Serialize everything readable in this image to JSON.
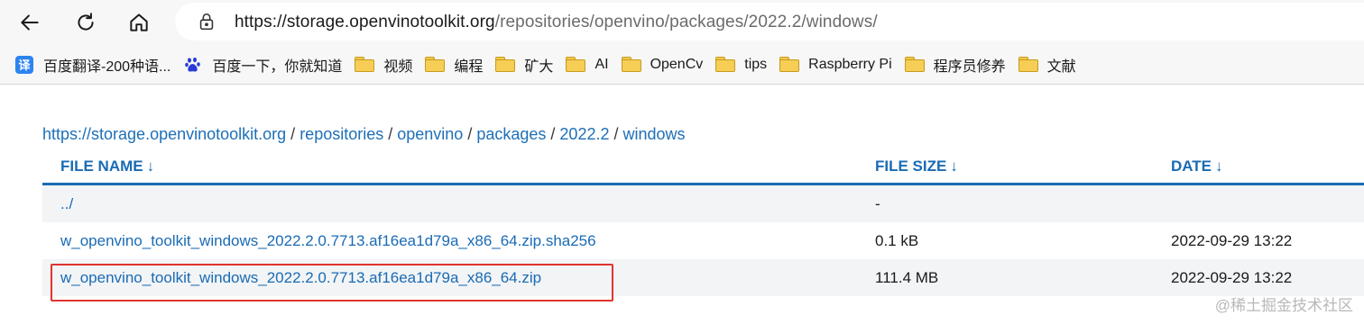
{
  "browser": {
    "url_host": "https://storage.openvinotoolkit.org",
    "url_path": "/repositories/openvino/packages/2022.2/windows/",
    "back_icon": "arrow-left-icon",
    "refresh_icon": "refresh-icon",
    "home_icon": "home-icon",
    "lock_icon": "lock-icon"
  },
  "bookmarks": [
    {
      "label": "百度翻译-200种语...",
      "icon": "translate-icon"
    },
    {
      "label": "百度一下，你就知道",
      "icon": "baidu-paw-icon"
    },
    {
      "label": "视频",
      "icon": "folder-icon"
    },
    {
      "label": "编程",
      "icon": "folder-icon"
    },
    {
      "label": "矿大",
      "icon": "folder-icon"
    },
    {
      "label": "AI",
      "icon": "folder-icon"
    },
    {
      "label": "OpenCv",
      "icon": "folder-icon"
    },
    {
      "label": "tips",
      "icon": "folder-icon"
    },
    {
      "label": "Raspberry Pi",
      "icon": "folder-icon"
    },
    {
      "label": "程序员修养",
      "icon": "folder-icon"
    },
    {
      "label": "文献",
      "icon": "folder-icon"
    }
  ],
  "breadcrumb": {
    "items": [
      "https://storage.openvinotoolkit.org",
      "repositories",
      "openvino",
      "packages",
      "2022.2",
      "windows"
    ],
    "separator": "/"
  },
  "table": {
    "headers": {
      "name": "FILE NAME",
      "size": "FILE SIZE",
      "date": "DATE",
      "sort_arrow": "↓"
    },
    "rows": [
      {
        "name": "../",
        "size": "-",
        "date": ""
      },
      {
        "name": "w_openvino_toolkit_windows_2022.2.0.7713.af16ea1d79a_x86_64.zip.sha256",
        "size": "0.1 kB",
        "date": "2022-09-29 13:22"
      },
      {
        "name": "w_openvino_toolkit_windows_2022.2.0.7713.af16ea1d79a_x86_64.zip",
        "size": "111.4 MB",
        "date": "2022-09-29 13:22"
      }
    ]
  },
  "watermark": "@稀土掘金技术社区",
  "colors": {
    "link": "#1a6bb4",
    "header_rule": "#1a6bb4",
    "highlight_box": "#e0332f",
    "row_alt": "#f2f4f6"
  }
}
